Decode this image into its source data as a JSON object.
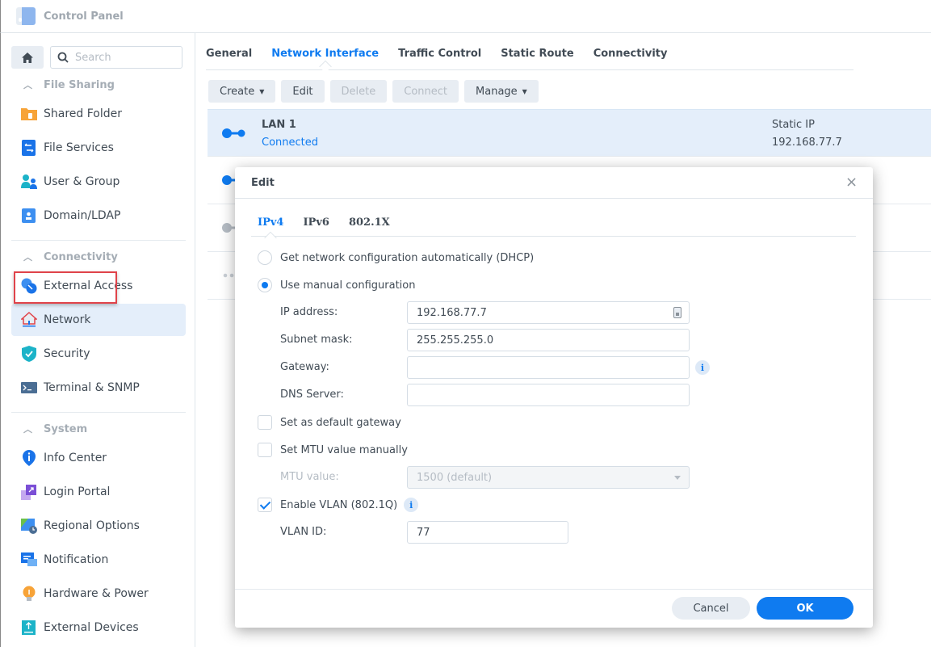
{
  "app": {
    "title": "Control Panel",
    "icon": "control-panel-icon"
  },
  "sidebar": {
    "search_placeholder": "Search",
    "sections": [
      {
        "label": "File Sharing",
        "items": [
          {
            "label": "Shared Folder",
            "icon": "shared-folder-icon"
          },
          {
            "label": "File Services",
            "icon": "file-services-icon"
          },
          {
            "label": "User & Group",
            "icon": "user-group-icon"
          },
          {
            "label": "Domain/LDAP",
            "icon": "domain-ldap-icon"
          }
        ]
      },
      {
        "label": "Connectivity",
        "items": [
          {
            "label": "External Access",
            "icon": "external-access-icon"
          },
          {
            "label": "Network",
            "icon": "network-icon",
            "active": true
          },
          {
            "label": "Security",
            "icon": "security-icon"
          },
          {
            "label": "Terminal & SNMP",
            "icon": "terminal-icon"
          }
        ]
      },
      {
        "label": "System",
        "items": [
          {
            "label": "Info Center",
            "icon": "info-center-icon"
          },
          {
            "label": "Login Portal",
            "icon": "login-portal-icon"
          },
          {
            "label": "Regional Options",
            "icon": "regional-options-icon"
          },
          {
            "label": "Notification",
            "icon": "notification-icon"
          },
          {
            "label": "Hardware & Power",
            "icon": "hardware-power-icon"
          },
          {
            "label": "External Devices",
            "icon": "external-devices-icon"
          }
        ]
      }
    ]
  },
  "main": {
    "tabs": [
      {
        "label": "General"
      },
      {
        "label": "Network Interface",
        "active": true
      },
      {
        "label": "Traffic Control"
      },
      {
        "label": "Static Route"
      },
      {
        "label": "Connectivity"
      }
    ],
    "toolbar": {
      "create": "Create",
      "edit": "Edit",
      "delete": "Delete",
      "connect": "Connect",
      "manage": "Manage"
    },
    "interfaces": [
      {
        "name": "LAN 1",
        "status": "Connected",
        "type": "Static IP",
        "ip": "192.168.77.7"
      }
    ]
  },
  "dialog": {
    "title": "Edit",
    "tabs": [
      {
        "label": "IPv4",
        "active": true
      },
      {
        "label": "IPv6"
      },
      {
        "label": "802.1X"
      }
    ],
    "dhcp_label": "Get network configuration automatically (DHCP)",
    "manual_label": "Use manual configuration",
    "mode": "manual",
    "fields": {
      "ip_label": "IP address:",
      "ip_value": "192.168.77.7",
      "subnet_label": "Subnet mask:",
      "subnet_value": "255.255.255.0",
      "gateway_label": "Gateway:",
      "gateway_value": "",
      "dns_label": "DNS Server:",
      "dns_value": ""
    },
    "default_gateway_label": "Set as default gateway",
    "default_gateway_checked": false,
    "mtu_manual_label": "Set MTU value manually",
    "mtu_manual_checked": false,
    "mtu_label": "MTU value:",
    "mtu_value": "1500 (default)",
    "vlan_label": "Enable VLAN (802.1Q)",
    "vlan_checked": true,
    "vlan_id_label": "VLAN ID:",
    "vlan_id_value": "77",
    "cancel_label": "Cancel",
    "ok_label": "OK"
  },
  "colors": {
    "accent": "#0f7bf0",
    "highlight": "#e0434a",
    "selected_bg": "#e4eefa"
  }
}
